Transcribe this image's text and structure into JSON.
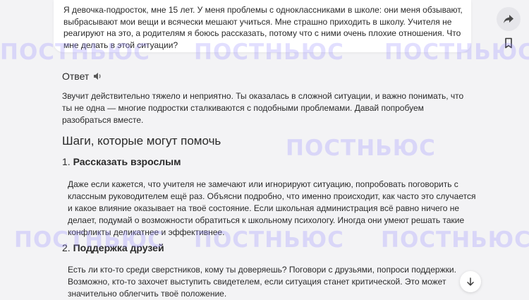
{
  "prompt": {
    "text": "Я девочка-подросток, мне 15 лет. У меня проблемы с одноклассниками в школе: они меня обзывают, выбрасывают мои вещи и всячески мешают учиться. Мне страшно приходить в школу. Учителя не реагируют на это, а родителям я боюсь рассказать, потому что с ними очень плохие отношения. Что мне делать в этой ситуации?"
  },
  "answer": {
    "label": "Ответ",
    "intro": "Звучит действительно тяжело и неприятно. Ты оказалась в сложной ситуации, и важно понимать, что ты не одна — многие подростки сталкиваются с подобными проблемами. Давай попробуем разобраться вместе.",
    "steps_heading": "Шаги, которые могут помочь",
    "steps": [
      {
        "number": "1.",
        "title": "Рассказать взрослым",
        "text": "Даже если кажется, что учителя не замечают или игнорируют ситуацию, попробовать поговорить с классным руководителем ещё раз. Объясни подробно, что именно происходит, как часто это случается и какое влияние оказывает на твоё состояние. Если школьная администрация всё равно ничего не делает, подумай о возможности обратиться к школьному психологу. Иногда они умеют решать такие конфликты деликатнее и эффективнее."
      },
      {
        "number": "2.",
        "title": "Поддержка друзей",
        "text": "Есть ли кто-то среди сверстников, кому ты доверяешь? Поговори с друзьями, попроси поддержки. Возможно, кто-то захочет выступить свидетелем, если ситуация станет критической. Это может значительно облегчить твоё положение."
      }
    ]
  },
  "watermark": "ПОСТНЬЮС",
  "icons": {
    "share": "share-arrow-icon",
    "bookmark": "bookmark-icon",
    "speaker": "speaker-icon",
    "scroll_down": "arrow-down-icon"
  }
}
